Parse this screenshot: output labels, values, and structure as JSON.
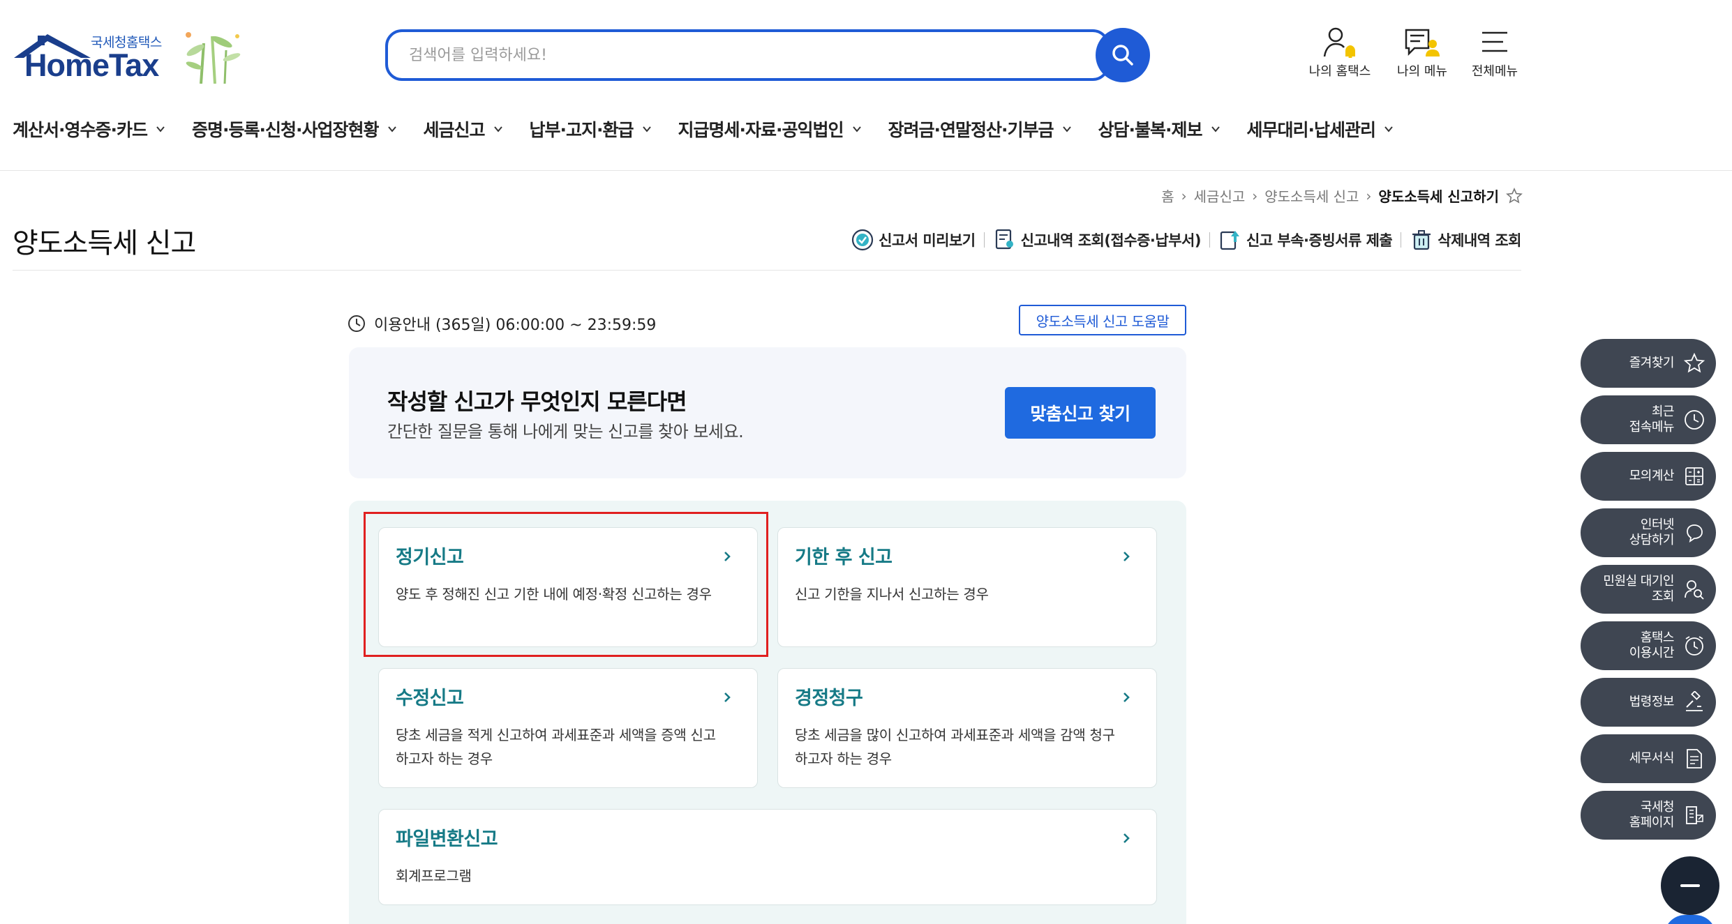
{
  "header": {
    "logo_kor": "국세청홈택스",
    "logo_eng": "HomeTax",
    "search_placeholder": "검색어를 입력하세요!",
    "icons": [
      {
        "label": "나의 홈택스",
        "icon": "my-hometax-icon"
      },
      {
        "label": "나의 메뉴",
        "icon": "my-menu-icon"
      },
      {
        "label": "전체메뉴",
        "icon": "hamburger-icon"
      }
    ]
  },
  "nav": {
    "items": [
      "계산서·영수증·카드",
      "증명·등록·신청·사업장현황",
      "세금신고",
      "납부·고지·환급",
      "지급명세·자료·공익법인",
      "장려금·연말정산·기부금",
      "상담·불복·제보",
      "세무대리·납세관리"
    ]
  },
  "breadcrumb": [
    "홈",
    "세금신고",
    "양도소득세 신고",
    "양도소득세 신고하기"
  ],
  "page_title": "양도소득세 신고",
  "utility_links": [
    {
      "label": "신고서 미리보기",
      "icon": "check-badge-icon"
    },
    {
      "label": "신고내역 조회(접수증·납부서)",
      "icon": "document-search-icon"
    },
    {
      "label": "신고 부속·증빙서류 제출",
      "icon": "upload-document-icon"
    },
    {
      "label": "삭제내역 조회",
      "icon": "trash-icon"
    }
  ],
  "usage_info": "이용안내 (365일) 06:00:00 ~ 23:59:59",
  "help_button": "양도소득세 신고 도움말",
  "finder": {
    "heading": "작성할 신고가 무엇인지 모른다면",
    "description": "간단한 질문을 통해 나에게 맞는 신고를 찾아 보세요.",
    "button": "맞춤신고 찾기"
  },
  "cards": [
    {
      "title": "정기신고",
      "desc": "양도 후 정해진 신고 기한 내에 예정·확정 신고하는 경우"
    },
    {
      "title": "기한 후 신고",
      "desc": "신고 기한을 지나서 신고하는 경우"
    },
    {
      "title": "수정신고",
      "desc": "당초 세금을 적게 신고하여 과세표준과 세액을 증액 신고하고자 하는 경우"
    },
    {
      "title": "경정청구",
      "desc": "당초 세금을 많이 신고하여 과세표준과 세액을 감액 청구하고자 하는 경우"
    },
    {
      "title": "파일변환신고",
      "desc": "회계프로그램"
    }
  ],
  "quick_menu": [
    {
      "label": "즐겨찾기",
      "icon": "star-icon"
    },
    {
      "label": "최근\n접속메뉴",
      "icon": "clock-icon"
    },
    {
      "label": "모의계산",
      "icon": "calculator-icon"
    },
    {
      "label": "인터넷\n상담하기",
      "icon": "chat-icon"
    },
    {
      "label": "민원실 대기인\n조회",
      "icon": "person-search-icon"
    },
    {
      "label": "홈택스\n이용시간",
      "icon": "alarm-clock-icon"
    },
    {
      "label": "법령정보",
      "icon": "gavel-icon"
    },
    {
      "label": "세무서식",
      "icon": "form-document-icon"
    },
    {
      "label": "국세청\n홈페이지",
      "icon": "building-link-icon"
    }
  ],
  "colors": {
    "primary": "#1f5bd6",
    "button_blue": "#1f6ae0",
    "card_title": "#167a86",
    "highlight": "#e02020",
    "quick_bg": "#3f4652"
  }
}
